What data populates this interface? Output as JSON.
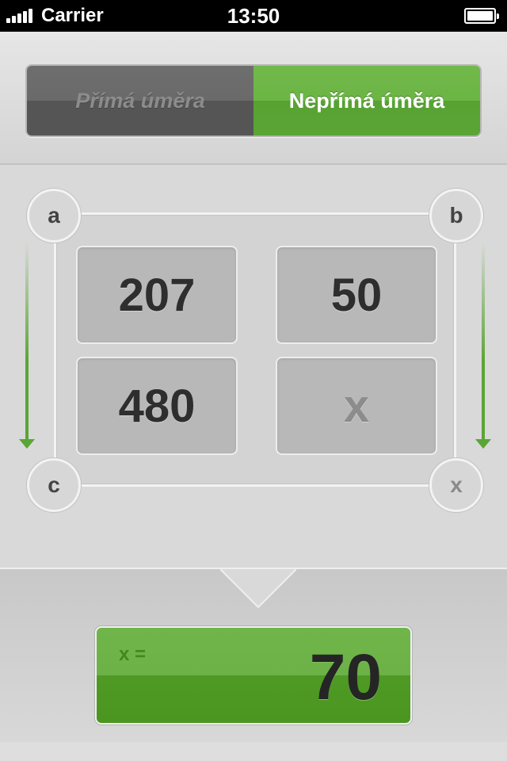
{
  "status_bar": {
    "carrier": "Carrier",
    "time": "13:50"
  },
  "mode_selector": {
    "direct_label": "Přímá úměra",
    "inverse_label": "Nepřímá úměra",
    "selected": "inverse"
  },
  "proportion": {
    "corners": {
      "a": "a",
      "b": "b",
      "c": "c",
      "x": "x"
    },
    "cells": {
      "a": "207",
      "b": "50",
      "c": "480",
      "x": "x"
    }
  },
  "result": {
    "label": "x =",
    "value": "70"
  },
  "colors": {
    "accent_green": "#5aa535",
    "dark_segment": "#555555"
  }
}
